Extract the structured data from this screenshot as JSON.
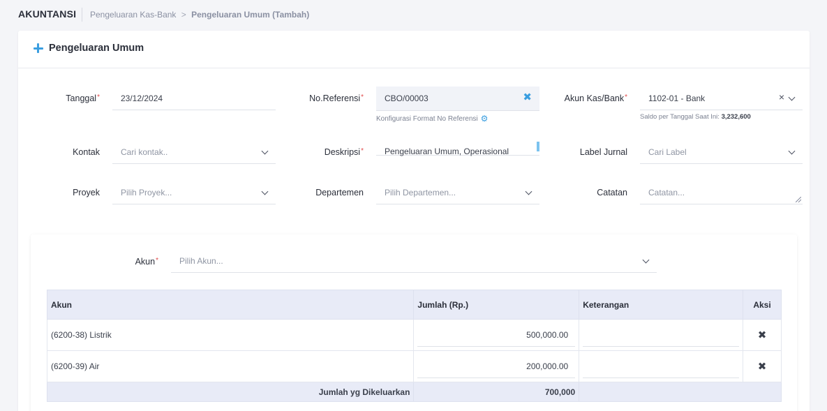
{
  "header": {
    "app_title": "AKUNTANSI",
    "breadcrumb_parent": "Pengeluaran Kas-Bank",
    "breadcrumb_separator": ">",
    "breadcrumb_current": "Pengeluaran Umum (Tambah)"
  },
  "form": {
    "title": "Pengeluaran Umum",
    "required_mark": "*",
    "tanggal": {
      "label": "Tanggal",
      "value": "23/12/2024"
    },
    "no_referensi": {
      "label": "No.Referensi",
      "value": "CBO/00003",
      "clear_icon": "✖",
      "config_link": "Konfigurasi Format No Referensi"
    },
    "akun_kas_bank": {
      "label": "Akun Kas/Bank",
      "value": "1102-01 - Bank",
      "clear_icon": "×",
      "saldo_label": "Saldo per Tanggal Saat Ini:",
      "saldo_value": "3,232,600"
    },
    "kontak": {
      "label": "Kontak",
      "placeholder": "Cari kontak.."
    },
    "deskripsi": {
      "label": "Deskripsi",
      "value": "Pengeluaran Umum, Operasional"
    },
    "label_jurnal": {
      "label": "Label Jurnal",
      "placeholder": "Cari Label"
    },
    "proyek": {
      "label": "Proyek",
      "placeholder": "Pilih Proyek..."
    },
    "departemen": {
      "label": "Departemen",
      "placeholder": "Pilih Departemen..."
    },
    "catatan": {
      "label": "Catatan",
      "placeholder": "Catatan..."
    }
  },
  "lines": {
    "akun_label": "Akun",
    "akun_placeholder": "Pilih Akun...",
    "columns": [
      "Akun",
      "Jumlah (Rp.)",
      "Keterangan",
      "Aksi"
    ],
    "rows": [
      {
        "akun": "(6200-38) Listrik",
        "jumlah": "500,000.00",
        "keterangan": ""
      },
      {
        "akun": "(6200-39) Air",
        "jumlah": "200,000.00",
        "keterangan": ""
      }
    ],
    "delete_icon": "✖",
    "total_label": "Jumlah yg Dikeluarkan",
    "total_value": "700,000"
  },
  "icons": {
    "plus": "plus-icon",
    "chevron": "chevron-down-icon",
    "gear": "gear-icon",
    "delete": "delete-icon"
  },
  "colors": {
    "accent": "#3a9ee0",
    "required": "#e04a4a",
    "table_header": "#e8ebf7"
  }
}
